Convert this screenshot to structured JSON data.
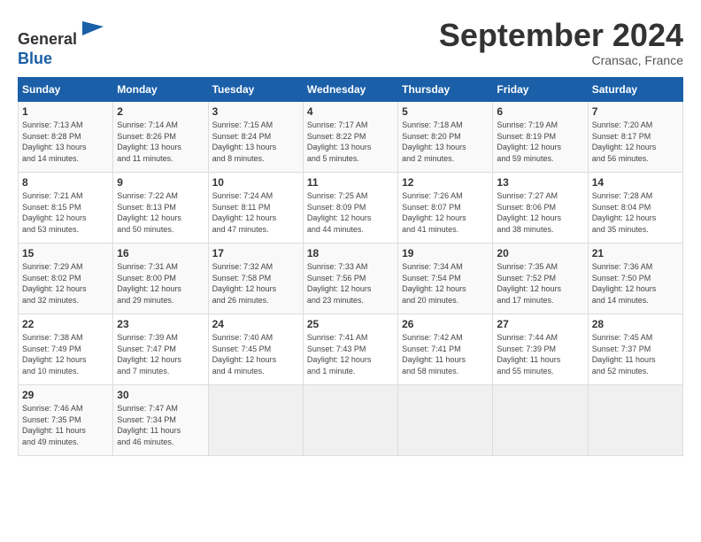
{
  "header": {
    "logo_line1": "General",
    "logo_line2": "Blue",
    "month_title": "September 2024",
    "location": "Cransac, France"
  },
  "days_of_week": [
    "Sunday",
    "Monday",
    "Tuesday",
    "Wednesday",
    "Thursday",
    "Friday",
    "Saturday"
  ],
  "weeks": [
    [
      {
        "day": "1",
        "sunrise": "7:13 AM",
        "sunset": "8:28 PM",
        "daylight": "13 hours and 14 minutes."
      },
      {
        "day": "2",
        "sunrise": "7:14 AM",
        "sunset": "8:26 PM",
        "daylight": "13 hours and 11 minutes."
      },
      {
        "day": "3",
        "sunrise": "7:15 AM",
        "sunset": "8:24 PM",
        "daylight": "13 hours and 8 minutes."
      },
      {
        "day": "4",
        "sunrise": "7:17 AM",
        "sunset": "8:22 PM",
        "daylight": "13 hours and 5 minutes."
      },
      {
        "day": "5",
        "sunrise": "7:18 AM",
        "sunset": "8:20 PM",
        "daylight": "13 hours and 2 minutes."
      },
      {
        "day": "6",
        "sunrise": "7:19 AM",
        "sunset": "8:19 PM",
        "daylight": "12 hours and 59 minutes."
      },
      {
        "day": "7",
        "sunrise": "7:20 AM",
        "sunset": "8:17 PM",
        "daylight": "12 hours and 56 minutes."
      }
    ],
    [
      {
        "day": "8",
        "sunrise": "7:21 AM",
        "sunset": "8:15 PM",
        "daylight": "12 hours and 53 minutes."
      },
      {
        "day": "9",
        "sunrise": "7:22 AM",
        "sunset": "8:13 PM",
        "daylight": "12 hours and 50 minutes."
      },
      {
        "day": "10",
        "sunrise": "7:24 AM",
        "sunset": "8:11 PM",
        "daylight": "12 hours and 47 minutes."
      },
      {
        "day": "11",
        "sunrise": "7:25 AM",
        "sunset": "8:09 PM",
        "daylight": "12 hours and 44 minutes."
      },
      {
        "day": "12",
        "sunrise": "7:26 AM",
        "sunset": "8:07 PM",
        "daylight": "12 hours and 41 minutes."
      },
      {
        "day": "13",
        "sunrise": "7:27 AM",
        "sunset": "8:06 PM",
        "daylight": "12 hours and 38 minutes."
      },
      {
        "day": "14",
        "sunrise": "7:28 AM",
        "sunset": "8:04 PM",
        "daylight": "12 hours and 35 minutes."
      }
    ],
    [
      {
        "day": "15",
        "sunrise": "7:29 AM",
        "sunset": "8:02 PM",
        "daylight": "12 hours and 32 minutes."
      },
      {
        "day": "16",
        "sunrise": "7:31 AM",
        "sunset": "8:00 PM",
        "daylight": "12 hours and 29 minutes."
      },
      {
        "day": "17",
        "sunrise": "7:32 AM",
        "sunset": "7:58 PM",
        "daylight": "12 hours and 26 minutes."
      },
      {
        "day": "18",
        "sunrise": "7:33 AM",
        "sunset": "7:56 PM",
        "daylight": "12 hours and 23 minutes."
      },
      {
        "day": "19",
        "sunrise": "7:34 AM",
        "sunset": "7:54 PM",
        "daylight": "12 hours and 20 minutes."
      },
      {
        "day": "20",
        "sunrise": "7:35 AM",
        "sunset": "7:52 PM",
        "daylight": "12 hours and 17 minutes."
      },
      {
        "day": "21",
        "sunrise": "7:36 AM",
        "sunset": "7:50 PM",
        "daylight": "12 hours and 14 minutes."
      }
    ],
    [
      {
        "day": "22",
        "sunrise": "7:38 AM",
        "sunset": "7:49 PM",
        "daylight": "12 hours and 10 minutes."
      },
      {
        "day": "23",
        "sunrise": "7:39 AM",
        "sunset": "7:47 PM",
        "daylight": "12 hours and 7 minutes."
      },
      {
        "day": "24",
        "sunrise": "7:40 AM",
        "sunset": "7:45 PM",
        "daylight": "12 hours and 4 minutes."
      },
      {
        "day": "25",
        "sunrise": "7:41 AM",
        "sunset": "7:43 PM",
        "daylight": "12 hours and 1 minute."
      },
      {
        "day": "26",
        "sunrise": "7:42 AM",
        "sunset": "7:41 PM",
        "daylight": "11 hours and 58 minutes."
      },
      {
        "day": "27",
        "sunrise": "7:44 AM",
        "sunset": "7:39 PM",
        "daylight": "11 hours and 55 minutes."
      },
      {
        "day": "28",
        "sunrise": "7:45 AM",
        "sunset": "7:37 PM",
        "daylight": "11 hours and 52 minutes."
      }
    ],
    [
      {
        "day": "29",
        "sunrise": "7:46 AM",
        "sunset": "7:35 PM",
        "daylight": "11 hours and 49 minutes."
      },
      {
        "day": "30",
        "sunrise": "7:47 AM",
        "sunset": "7:34 PM",
        "daylight": "11 hours and 46 minutes."
      },
      null,
      null,
      null,
      null,
      null
    ]
  ],
  "labels": {
    "sunrise": "Sunrise:",
    "sunset": "Sunset:",
    "daylight": "Daylight hours"
  }
}
